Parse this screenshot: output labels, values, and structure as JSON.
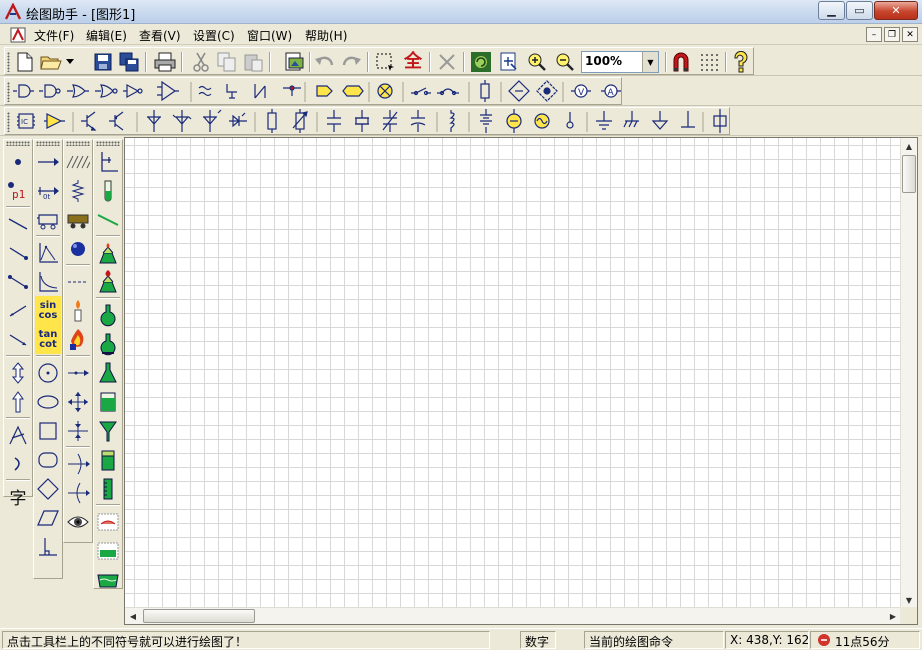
{
  "window": {
    "title": "绘图助手 - [图形1]"
  },
  "menu": {
    "items": [
      "文件(F)",
      "编辑(E)",
      "查看(V)",
      "设置(C)",
      "窗口(W)",
      "帮助(H)"
    ]
  },
  "toolbar": {
    "zoom_value": "100%"
  },
  "palette": {
    "pressure_label": "p1",
    "trig1_top": "sin",
    "trig1_bottom": "cos",
    "trig2_top": "tan",
    "trig2_bottom": "cot",
    "text_tool": "字"
  },
  "status": {
    "hint": "点击工具栏上的不同符号就可以进行绘图了！",
    "mode": "数字",
    "command": "当前的绘图命令",
    "coords": "X: 438,Y: 162",
    "clock": "11点56分"
  },
  "colors": {
    "canvas_grid": "#d8d8d8",
    "title_bar": "#c9d9ee",
    "chrome": "#ece9d8",
    "accent_green": "#1aa845"
  }
}
